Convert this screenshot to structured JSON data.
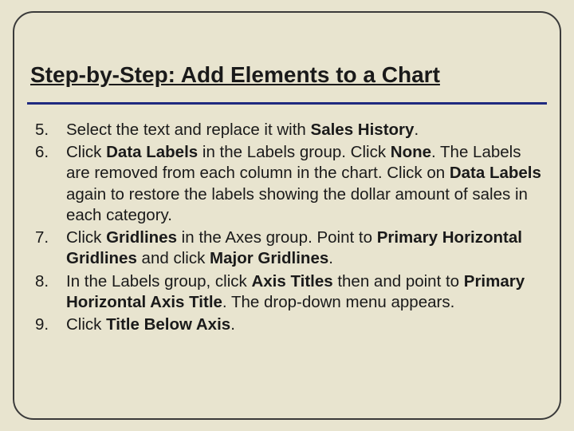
{
  "heading": "Step-by-Step: Add Elements to a Chart",
  "list_start": 5,
  "steps": [
    {
      "parts": [
        {
          "t": "Select the text and replace it with "
        },
        {
          "t": "Sales History",
          "b": true
        },
        {
          "t": "."
        }
      ]
    },
    {
      "parts": [
        {
          "t": "Click "
        },
        {
          "t": "Data Labels",
          "b": true
        },
        {
          "t": " in the Labels group. Click "
        },
        {
          "t": "None",
          "b": true
        },
        {
          "t": ". The Labels are removed from each column in the chart. Click on "
        },
        {
          "t": "Data Labels",
          "b": true
        },
        {
          "t": " again to restore the labels showing the dollar amount of sales in each category."
        }
      ]
    },
    {
      "parts": [
        {
          "t": "Click "
        },
        {
          "t": "Gridlines",
          "b": true
        },
        {
          "t": " in the Axes group. Point to "
        },
        {
          "t": "Primary Horizontal Gridlines",
          "b": true
        },
        {
          "t": " and click "
        },
        {
          "t": "Major Gridlines",
          "b": true
        },
        {
          "t": "."
        }
      ]
    },
    {
      "parts": [
        {
          "t": "In the Labels group, click "
        },
        {
          "t": "Axis Titles",
          "b": true
        },
        {
          "t": " then and point to "
        },
        {
          "t": "Primary Horizontal Axis Title",
          "b": true
        },
        {
          "t": ". The drop-down menu appears."
        }
      ]
    },
    {
      "parts": [
        {
          "t": "Click "
        },
        {
          "t": "Title Below Axis",
          "b": true
        },
        {
          "t": "."
        }
      ]
    }
  ]
}
